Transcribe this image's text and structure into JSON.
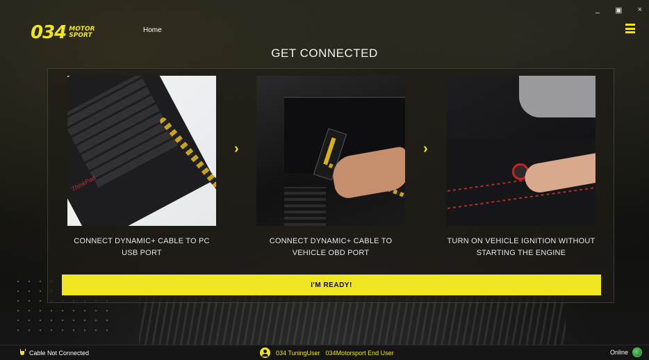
{
  "window": {
    "minimize": "_",
    "restore": "▣",
    "close": "×"
  },
  "header": {
    "logo_number": "034",
    "logo_word_line1": "MOTOR",
    "logo_word_line2": "SPORT",
    "nav_home": "Home",
    "menu_icon": "hamburger-menu-icon"
  },
  "page": {
    "title": "GET CONNECTED"
  },
  "steps": [
    {
      "caption": "CONNECT DYNAMIC+ CABLE TO PC USB PORT",
      "photo_text": "ThinkPad"
    },
    {
      "caption": "CONNECT DYNAMIC+ CABLE TO VEHICLE OBD PORT"
    },
    {
      "caption": "TURN ON VEHICLE IGNITION WITHOUT STARTING THE ENGINE"
    }
  ],
  "arrows": {
    "glyph": "›"
  },
  "ready_button": {
    "label": "I'M READY!"
  },
  "status": {
    "cable": "Cable Not Connected",
    "user_name": "034 TuningUser",
    "user_role": "034Motorsport End User",
    "connection": "Online"
  },
  "colors": {
    "accent": "#f0e523",
    "background": "#101010",
    "panel": "#1e1c16"
  }
}
